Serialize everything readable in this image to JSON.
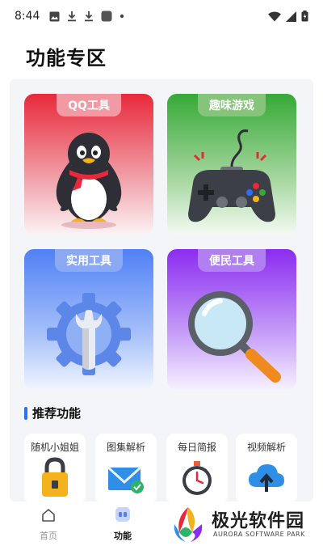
{
  "status_bar": {
    "time": "8:44"
  },
  "page": {
    "title": "功能专区"
  },
  "cards": [
    {
      "label": "QQ工具",
      "icon": "penguin-icon"
    },
    {
      "label": "趣味游戏",
      "icon": "gamepad-icon"
    },
    {
      "label": "实用工具",
      "icon": "wrench-gear-icon"
    },
    {
      "label": "便民工具",
      "icon": "magnifier-icon"
    }
  ],
  "recommend": {
    "title": "推荐功能",
    "items": [
      {
        "label": "随机小姐姐",
        "icon": "lock-icon"
      },
      {
        "label": "图集解析",
        "icon": "mail-check-icon"
      },
      {
        "label": "每日简报",
        "icon": "stopwatch-icon"
      },
      {
        "label": "视频解析",
        "icon": "cloud-upload-icon"
      }
    ]
  },
  "bottom_nav": {
    "items": [
      {
        "label": "首页",
        "icon": "home-icon",
        "active": false
      },
      {
        "label": "功能",
        "icon": "grid-icon",
        "active": true
      }
    ]
  },
  "watermark": {
    "text": "极光软件园",
    "sub": "AURORA SOFTWARE PARK"
  },
  "colors": {
    "accent": "#2f6df5",
    "qq": "#e8293b",
    "fun": "#36a936",
    "util": "#5080f6",
    "conv": "#8b2cf0"
  }
}
